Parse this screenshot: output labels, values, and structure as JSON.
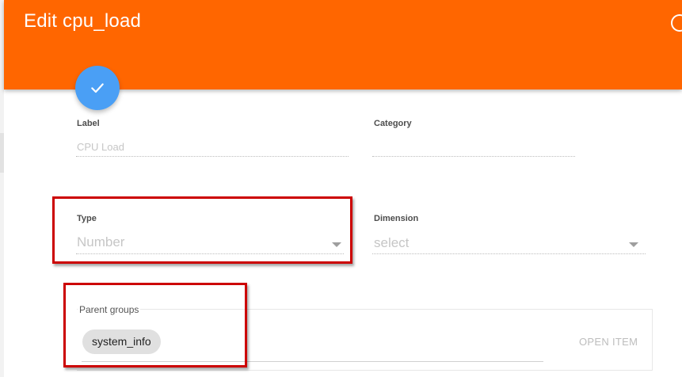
{
  "dialog": {
    "title": "Edit cpu_load"
  },
  "form": {
    "label": {
      "label": "Label",
      "value": "CPU Load"
    },
    "category": {
      "label": "Category",
      "value": ""
    },
    "type": {
      "label": "Type",
      "value": "Number"
    },
    "dimension": {
      "label": "Dimension",
      "value": "select"
    },
    "parent_groups": {
      "label": "Parent groups",
      "chips": [
        "system_info"
      ],
      "open_item_label": "OPEN ITEM"
    }
  },
  "icons": {
    "save": "check-icon",
    "dropdown": "chevron-down-icon"
  },
  "colors": {
    "header": "#ff6600",
    "fab": "#4a9ff5",
    "highlight": "#cc0000"
  }
}
